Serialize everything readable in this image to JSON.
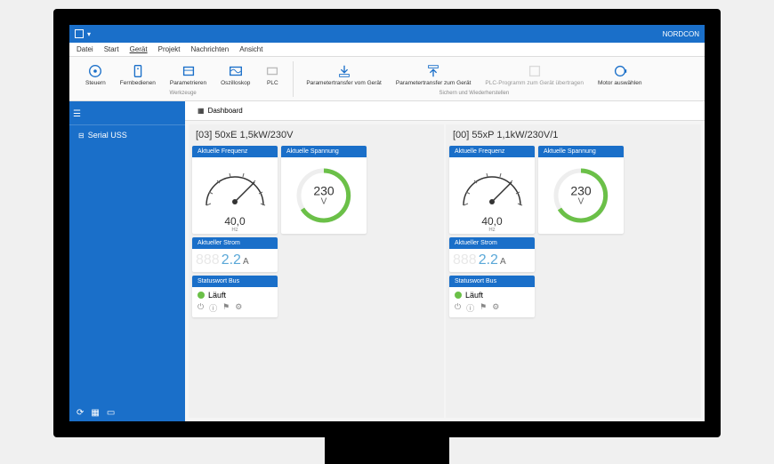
{
  "app": {
    "title": "NORDCON"
  },
  "menu": {
    "items": [
      "Datei",
      "Start",
      "Gerät",
      "Projekt",
      "Nachrichten",
      "Ansicht"
    ],
    "active_index": 2
  },
  "ribbon": {
    "group1_label": "Werkzeuge",
    "group2_label": "Sichern und Wiederherstellen",
    "buttons": {
      "steuern": "Steuern",
      "fernbedienen": "Fernbedienen",
      "parametrieren": "Parametrieren",
      "oszilloskop": "Oszilloskop",
      "plc": "PLC",
      "param_vom": "Parametertransfer vom Gerät",
      "param_zum": "Parametertransfer zum Gerät",
      "plc_prog": "PLC-Programm zum Gerät übertragen",
      "motor": "Motor auswählen"
    }
  },
  "sidebar": {
    "items": [
      {
        "label": "Serial USS"
      }
    ]
  },
  "tabs": {
    "dashboard": "Dashboard"
  },
  "devices": [
    {
      "title": "[03] 50xE 1,5kW/230V",
      "freq_label": "Aktuelle Frequenz",
      "freq_value": "40,0",
      "freq_unit": "Hz",
      "volt_label": "Aktuelle Spannung",
      "volt_value": "230",
      "volt_unit": "V",
      "curr_label": "Aktueller Strom",
      "curr_value": "2.2",
      "curr_unit": "A",
      "status_label": "Statuswort Bus",
      "status_text": "Läuft"
    },
    {
      "title": "[00] 55xP 1,1kW/230V/1",
      "freq_label": "Aktuelle Frequenz",
      "freq_value": "40,0",
      "freq_unit": "Hz",
      "volt_label": "Aktuelle Spannung",
      "volt_value": "230",
      "volt_unit": "V",
      "curr_label": "Aktueller Strom",
      "curr_value": "2.2",
      "curr_unit": "A",
      "status_label": "Statuswort Bus",
      "status_text": "Läuft"
    }
  ],
  "chart_data": [
    {
      "type": "gauge",
      "label": "Aktuelle Frequenz",
      "value": 40.0,
      "unit": "Hz",
      "min": 0,
      "max": 60,
      "needle_frac": 0.67
    },
    {
      "type": "donut",
      "label": "Aktuelle Spannung",
      "value": 230,
      "unit": "V",
      "arc_frac": 0.85,
      "color": "#6bc048"
    },
    {
      "type": "gauge",
      "label": "Aktuelle Frequenz",
      "value": 40.0,
      "unit": "Hz",
      "min": 0,
      "max": 60,
      "needle_frac": 0.67
    },
    {
      "type": "donut",
      "label": "Aktuelle Spannung",
      "value": 230,
      "unit": "V",
      "arc_frac": 0.85,
      "color": "#6bc048"
    }
  ]
}
